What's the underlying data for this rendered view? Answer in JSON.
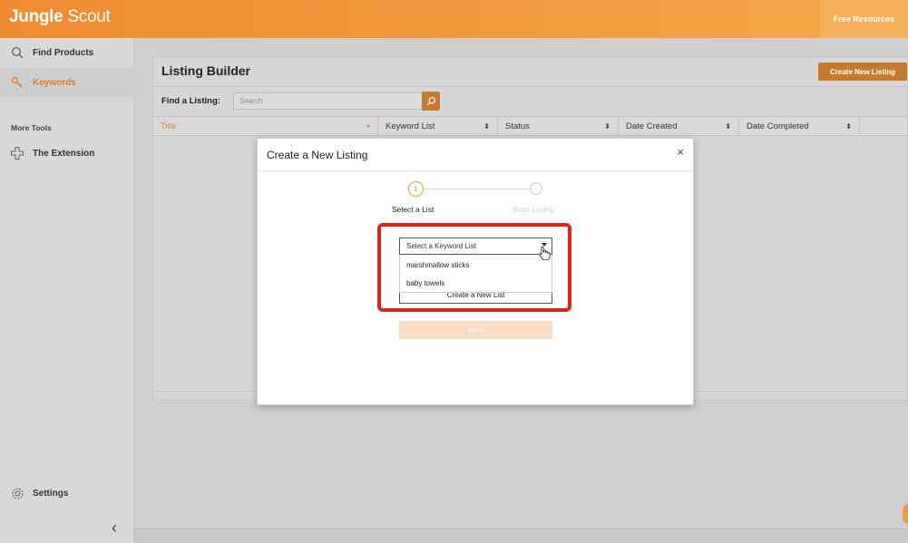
{
  "header": {
    "logo_bold": "Jungle",
    "logo_rest": "Scout",
    "free_resources": "Free Resources"
  },
  "sidebar": {
    "items": [
      {
        "label": "Find Products",
        "icon": "search-icon"
      },
      {
        "label": "Keywords",
        "icon": "key-icon"
      }
    ],
    "more_tools": "More Tools",
    "extension": {
      "label": "The Extension",
      "icon": "puzzle-icon"
    },
    "settings": {
      "label": "Settings",
      "icon": "gear-icon"
    }
  },
  "main": {
    "title": "Listing Builder",
    "create_button": "Create New Listing",
    "find_label": "Find a Listing:",
    "search_placeholder": "Search",
    "columns": [
      "Title",
      "Keyword List",
      "Status",
      "Date Created",
      "Date Completed"
    ]
  },
  "modal": {
    "title": "Create a New Listing",
    "close": "×",
    "steps": [
      {
        "number": "1",
        "label": "Select a List"
      },
      {
        "label": "Build Listing"
      }
    ],
    "select_placeholder": "Select a Keyword List",
    "options": [
      "marshmallow sticks",
      "baby towels"
    ],
    "create_list": "Create a New List",
    "next": "Next"
  },
  "colors": {
    "brand_orange": "#f39a3e",
    "accent_button": "#c77a2a",
    "highlight_red": "#e2231a"
  }
}
